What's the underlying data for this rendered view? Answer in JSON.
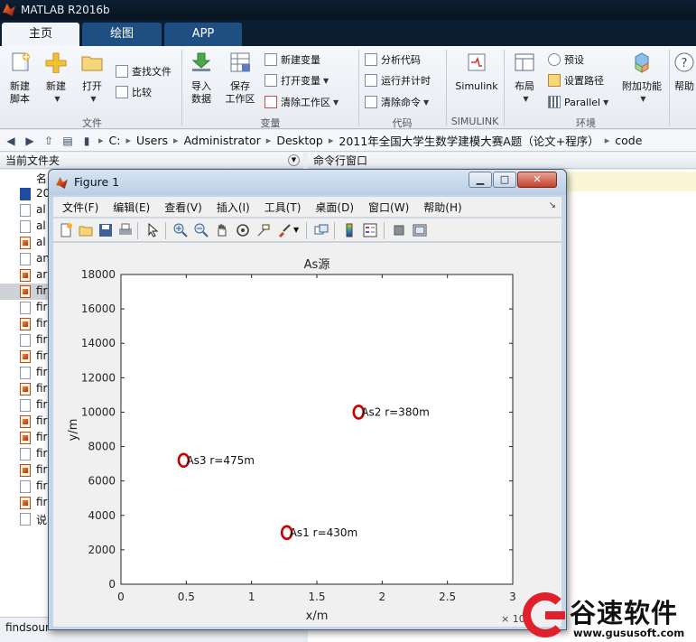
{
  "app": {
    "title": "MATLAB R2016b"
  },
  "tabs": [
    {
      "label": "主页",
      "active": true
    },
    {
      "label": "绘图",
      "active": false
    },
    {
      "label": "APP",
      "active": false
    }
  ],
  "ribbon": {
    "file": {
      "group_label": "文件",
      "new_script": "新建\n脚本",
      "new": "新建",
      "open": "打开",
      "find_files": "查找文件",
      "compare": "比较"
    },
    "variable": {
      "group_label": "变量",
      "import_data": "导入\n数据",
      "save_workspace": "保存\n工作区",
      "new_variable": "新建变量",
      "open_variable": "打开变量",
      "clear_workspace": "清除工作区"
    },
    "code": {
      "group_label": "代码",
      "analyze_code": "分析代码",
      "run_and_time": "运行并计时",
      "clear_commands": "清除命令"
    },
    "simulink": {
      "group_label": "SIMULINK",
      "simulink": "Simulink"
    },
    "environment": {
      "group_label": "环境",
      "layout": "布局",
      "preferences": "预设",
      "set_path": "设置路径",
      "parallel": "Parallel",
      "addons": "附加功能"
    },
    "help": "帮助"
  },
  "address": {
    "crumbs": [
      "C:",
      "Users",
      "Administrator",
      "Desktop",
      "2011年全国大学生数学建模大赛A题（论文+程序）",
      "code"
    ]
  },
  "current_folder": {
    "title": "当前文件夹",
    "files": [
      {
        "name": "名",
        "icon": "folder-header"
      },
      {
        "name": "20",
        "icon": "word"
      },
      {
        "name": "al",
        "icon": "file"
      },
      {
        "name": "al",
        "icon": "file"
      },
      {
        "name": "al",
        "icon": "matlab"
      },
      {
        "name": "an",
        "icon": "file"
      },
      {
        "name": "ar",
        "icon": "matlab"
      },
      {
        "name": "fir",
        "icon": "matlab",
        "selected": true
      },
      {
        "name": "fir",
        "icon": "file"
      },
      {
        "name": "fir",
        "icon": "matlab"
      },
      {
        "name": "fir",
        "icon": "file"
      },
      {
        "name": "fir",
        "icon": "matlab"
      },
      {
        "name": "fir",
        "icon": "file"
      },
      {
        "name": "fir",
        "icon": "matlab"
      },
      {
        "name": "fir",
        "icon": "file"
      },
      {
        "name": "fir",
        "icon": "matlab"
      },
      {
        "name": "fir",
        "icon": "matlab"
      },
      {
        "name": "fir",
        "icon": "file"
      },
      {
        "name": "fir",
        "icon": "matlab"
      },
      {
        "name": "fir",
        "icon": "file"
      },
      {
        "name": "fir",
        "icon": "matlab"
      },
      {
        "name": "说",
        "icon": "file"
      }
    ],
    "bottom_label": "findsour"
  },
  "command_window": {
    "title": "命令行窗口"
  },
  "figure": {
    "title": "Figure 1",
    "menu": [
      "文件(F)",
      "编辑(E)",
      "查看(V)",
      "插入(I)",
      "工具(T)",
      "桌面(D)",
      "窗口(W)",
      "帮助(H)"
    ],
    "toolbar_icons": [
      "new-figure-icon",
      "open-icon",
      "save-icon",
      "print-icon",
      "pointer-icon",
      "zoom-in-icon",
      "zoom-out-icon",
      "pan-icon",
      "rotate-icon",
      "data-cursor-icon",
      "brush-icon",
      "link-icon",
      "colorbar-icon",
      "legend-icon",
      "hide-plot-tools-icon",
      "show-plot-tools-icon"
    ]
  },
  "chart_data": {
    "type": "scatter",
    "title": "As源",
    "xlabel": "x/m",
    "ylabel": "y/m",
    "xlim": [
      0,
      30000
    ],
    "ylim": [
      0,
      18000
    ],
    "x_ticks": [
      0,
      5000,
      10000,
      15000,
      20000,
      25000,
      30000
    ],
    "x_tick_labels": [
      "0",
      "0.5",
      "1",
      "1.5",
      "2",
      "2.5",
      "3"
    ],
    "x_exponent": "× 10",
    "x_exponent_power": "4",
    "y_ticks": [
      0,
      2000,
      4000,
      6000,
      8000,
      10000,
      12000,
      14000,
      16000,
      18000
    ],
    "y_tick_labels": [
      "0",
      "2000",
      "4000",
      "6000",
      "8000",
      "10000",
      "12000",
      "14000",
      "16000",
      "18000"
    ],
    "marker_color": "#cc0000",
    "points": [
      {
        "x": 12700,
        "y": 3000,
        "label": "As1 r=430m"
      },
      {
        "x": 18200,
        "y": 10000,
        "label": "As2 r=380m"
      },
      {
        "x": 4800,
        "y": 7200,
        "label": "As3 r=475m"
      }
    ],
    "grid": false
  },
  "watermark": {
    "brand": "谷速软件",
    "url": "www.gususoft.com"
  }
}
